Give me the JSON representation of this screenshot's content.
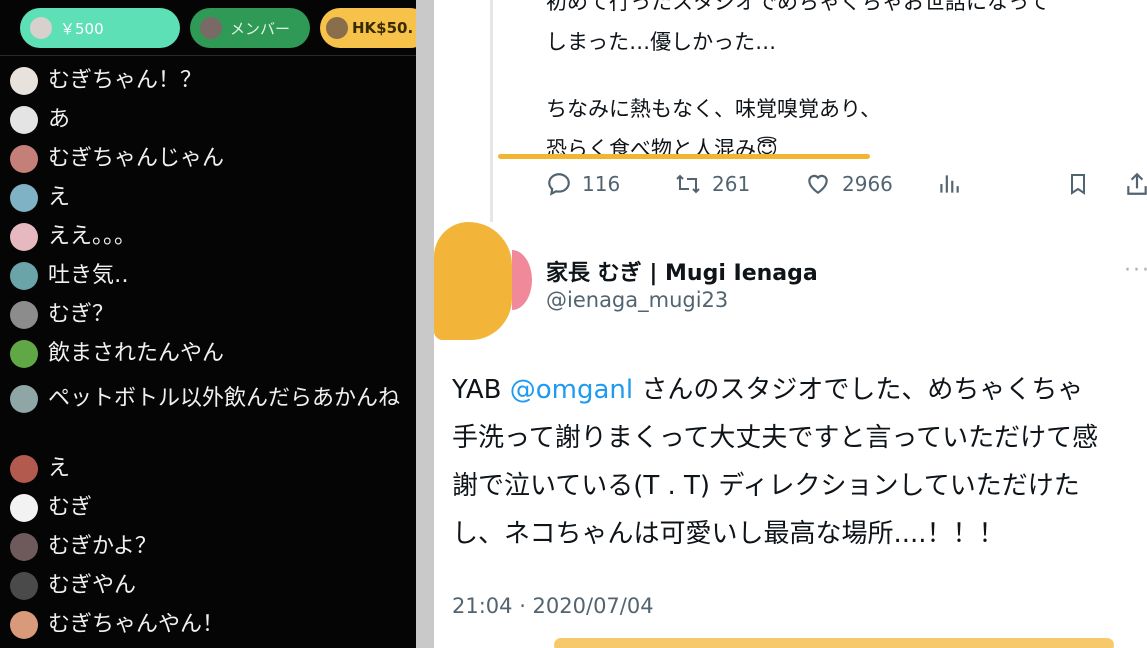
{
  "chat": {
    "pills": [
      {
        "label": "￥500"
      },
      {
        "label": "メンバー"
      },
      {
        "label": "HK$50."
      }
    ],
    "messages": [
      {
        "text": "むぎちゃん！？",
        "avatar_color": "#e8e2dc"
      },
      {
        "text": "あ",
        "avatar_color": "#e4e4e4"
      },
      {
        "text": "むぎちゃんじゃん",
        "avatar_color": "#c47f78"
      },
      {
        "text": "え",
        "avatar_color": "#7fb2c4"
      },
      {
        "text": "ええ。。。",
        "avatar_color": "#e6b8c0"
      },
      {
        "text": "吐き気‥",
        "avatar_color": "#6aa3a8"
      },
      {
        "text": "むぎ？",
        "avatar_color": "#8c8c8c"
      },
      {
        "text": "飲まされたんやん",
        "avatar_color": "#5fa845"
      },
      {
        "text": "ペットボトル以外飲んだらあかんね",
        "avatar_color": "#8fa6a6"
      },
      {
        "text": "え",
        "avatar_color": "#b35a4e"
      },
      {
        "text": "むぎ",
        "avatar_color": "#f2f2f2"
      },
      {
        "text": "むぎかよ？",
        "avatar_color": "#6e5a5a"
      },
      {
        "text": "むぎやん",
        "avatar_color": "#4a4a4a"
      },
      {
        "text": "むぎちゃんやん！",
        "avatar_color": "#d99a7a"
      }
    ]
  },
  "tweet": {
    "previous": {
      "line1": "初めて行ったスタジオでめちゃくちゃお世話になって",
      "line2": "しまった…優しかった…",
      "line3": "ちなみに熱もなく、味覚嗅覚あり、",
      "line4": "恐らく食べ物と人混み😇",
      "replies": "116",
      "retweets": "261",
      "likes": "2966"
    },
    "author": {
      "name": "家長 むぎ | Mugi Ienaga",
      "handle": "@ienaga_mugi23"
    },
    "body": {
      "line1_pre": "YAB ",
      "mention": "@omganl",
      "line1_post": " さんのスタジオでした、めちゃくちゃ",
      "line2": "手洗って謝りまくって大丈夫ですと言っていただけて感",
      "line3": "謝で泣いている(T . T) ディレクションしていただけた",
      "line4": "し、ネコちゃんは可愛いし最高な場所....！！！"
    },
    "timestamp": "21:04 · 2020/07/04",
    "more_label": "···"
  },
  "colors": {
    "highlight": "#f1b531",
    "link": "#1d9bf0",
    "muted": "#536471"
  }
}
